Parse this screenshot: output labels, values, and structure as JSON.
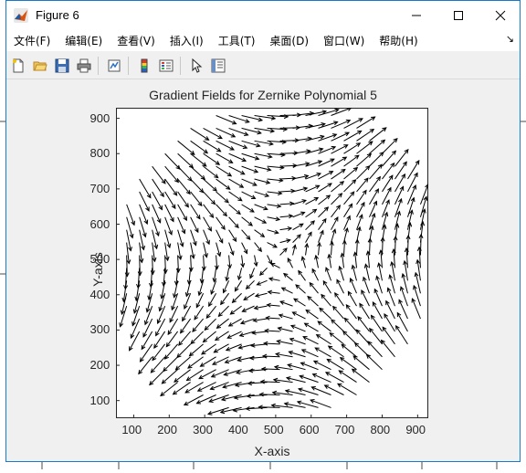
{
  "window": {
    "title": "Figure 6"
  },
  "menu": {
    "items": [
      "文件(F)",
      "编辑(E)",
      "查看(V)",
      "插入(I)",
      "工具(T)",
      "桌面(D)",
      "窗口(W)",
      "帮助(H)"
    ]
  },
  "toolbar": {
    "buttons": [
      "new-figure",
      "open-file",
      "save",
      "print",
      "link-plot",
      "insert-colorbar",
      "insert-legend",
      "edit-plot",
      "property-inspector"
    ]
  },
  "chart_data": {
    "type": "quiver",
    "title": "Gradient Fields for Zernike Polynomial 5",
    "xlabel": "X-axis",
    "ylabel": "Y-axis",
    "xlim": [
      50,
      930
    ],
    "ylim": [
      50,
      930
    ],
    "xticks": [
      100,
      200,
      300,
      400,
      500,
      600,
      700,
      800,
      900
    ],
    "yticks": [
      100,
      200,
      300,
      400,
      500,
      600,
      700,
      800,
      900
    ],
    "grid": false,
    "field": "gradient of Zernike polynomial 5 (astigmatism) over unit disk centered at (500,500), radius 450"
  },
  "colors": {
    "accent": "#1979ca",
    "arrow": "#000000",
    "axes": "#262626"
  }
}
